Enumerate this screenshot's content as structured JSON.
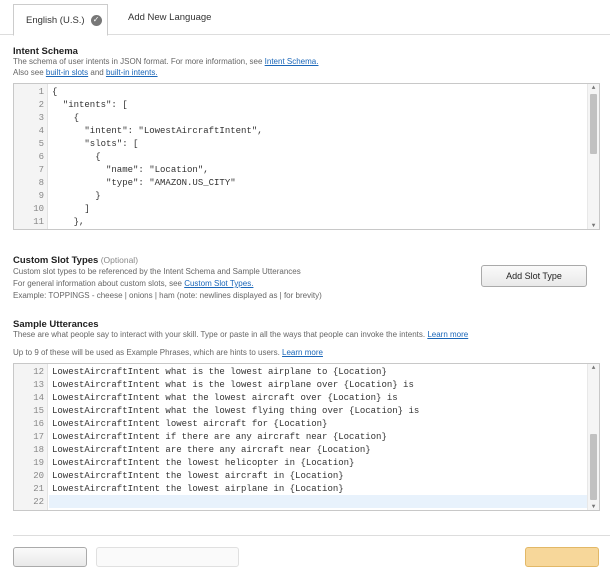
{
  "tabs": {
    "active_label": "English (U.S.)",
    "add_label": "Add New Language"
  },
  "intent_schema": {
    "title": "Intent Schema",
    "desc1_text": "The schema of user intents in JSON format. For more information, see ",
    "desc1_link": "Intent Schema.",
    "desc2_pre": "Also see ",
    "desc2_link1": "built-in slots",
    "desc2_mid": " and ",
    "desc2_link2": "built-in intents.",
    "line_numbers": [
      "1",
      "2",
      "3",
      "4",
      "5",
      "6",
      "7",
      "8",
      "9",
      "10",
      "11"
    ],
    "lines": [
      "{",
      "  \"intents\": [",
      "    {",
      "      \"intent\": \"LowestAircraftIntent\",",
      "      \"slots\": [",
      "        {",
      "          \"name\": \"Location\",",
      "          \"type\": \"AMAZON.US_CITY\"",
      "        }",
      "      ]",
      "    },"
    ]
  },
  "custom_slots": {
    "title": "Custom Slot Types",
    "optional": " (Optional)",
    "desc1": "Custom slot types to be referenced by the Intent Schema and Sample Utterances",
    "desc2_pre": "For general information about custom slots, see ",
    "desc2_link": "Custom Slot Types.",
    "example": "Example: TOPPINGS - cheese | onions | ham (note: newlines displayed as | for brevity)",
    "add_button": "Add Slot Type"
  },
  "sample_utterances": {
    "title": "Sample Utterances",
    "desc1_text": "These are what people say to interact with your skill. Type or paste in all the ways that people can invoke the intents. ",
    "desc1_link": "Learn more",
    "desc2_text": "Up to 9 of these will be used as Example Phrases, which are hints to users. ",
    "desc2_link": "Learn more",
    "line_numbers": [
      "12",
      "13",
      "14",
      "15",
      "16",
      "17",
      "18",
      "19",
      "20",
      "21",
      "22"
    ],
    "lines": [
      "LowestAircraftIntent what is the lowest airplane to {Location}",
      "LowestAircraftIntent what is the lowest airplane over {Location} is",
      "LowestAircraftIntent what the lowest aircraft over {Location} is",
      "LowestAircraftIntent what the lowest flying thing over {Location} is",
      "LowestAircraftIntent lowest aircraft for {Location}",
      "LowestAircraftIntent if there are any aircraft near {Location}",
      "LowestAircraftIntent are there any aircraft near {Location}",
      "LowestAircraftIntent the lowest helicopter in {Location}",
      "LowestAircraftIntent the lowest aircraft in {Location}",
      "LowestAircraftIntent the lowest airplane in {Location}",
      ""
    ]
  },
  "colors": {
    "link": "#1a66b8",
    "save_button": "#f7d79a"
  }
}
